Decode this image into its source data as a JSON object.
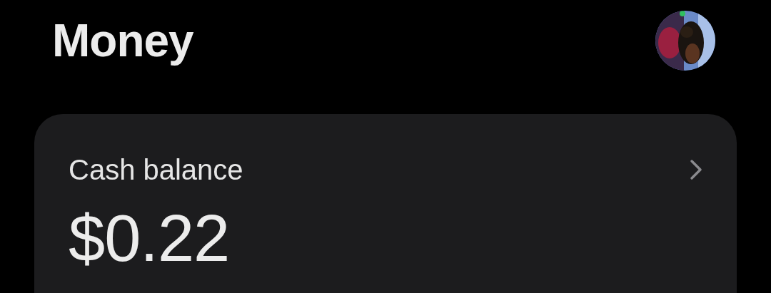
{
  "header": {
    "title": "Money"
  },
  "cash_card": {
    "label": "Cash balance",
    "amount": "$0.22"
  }
}
